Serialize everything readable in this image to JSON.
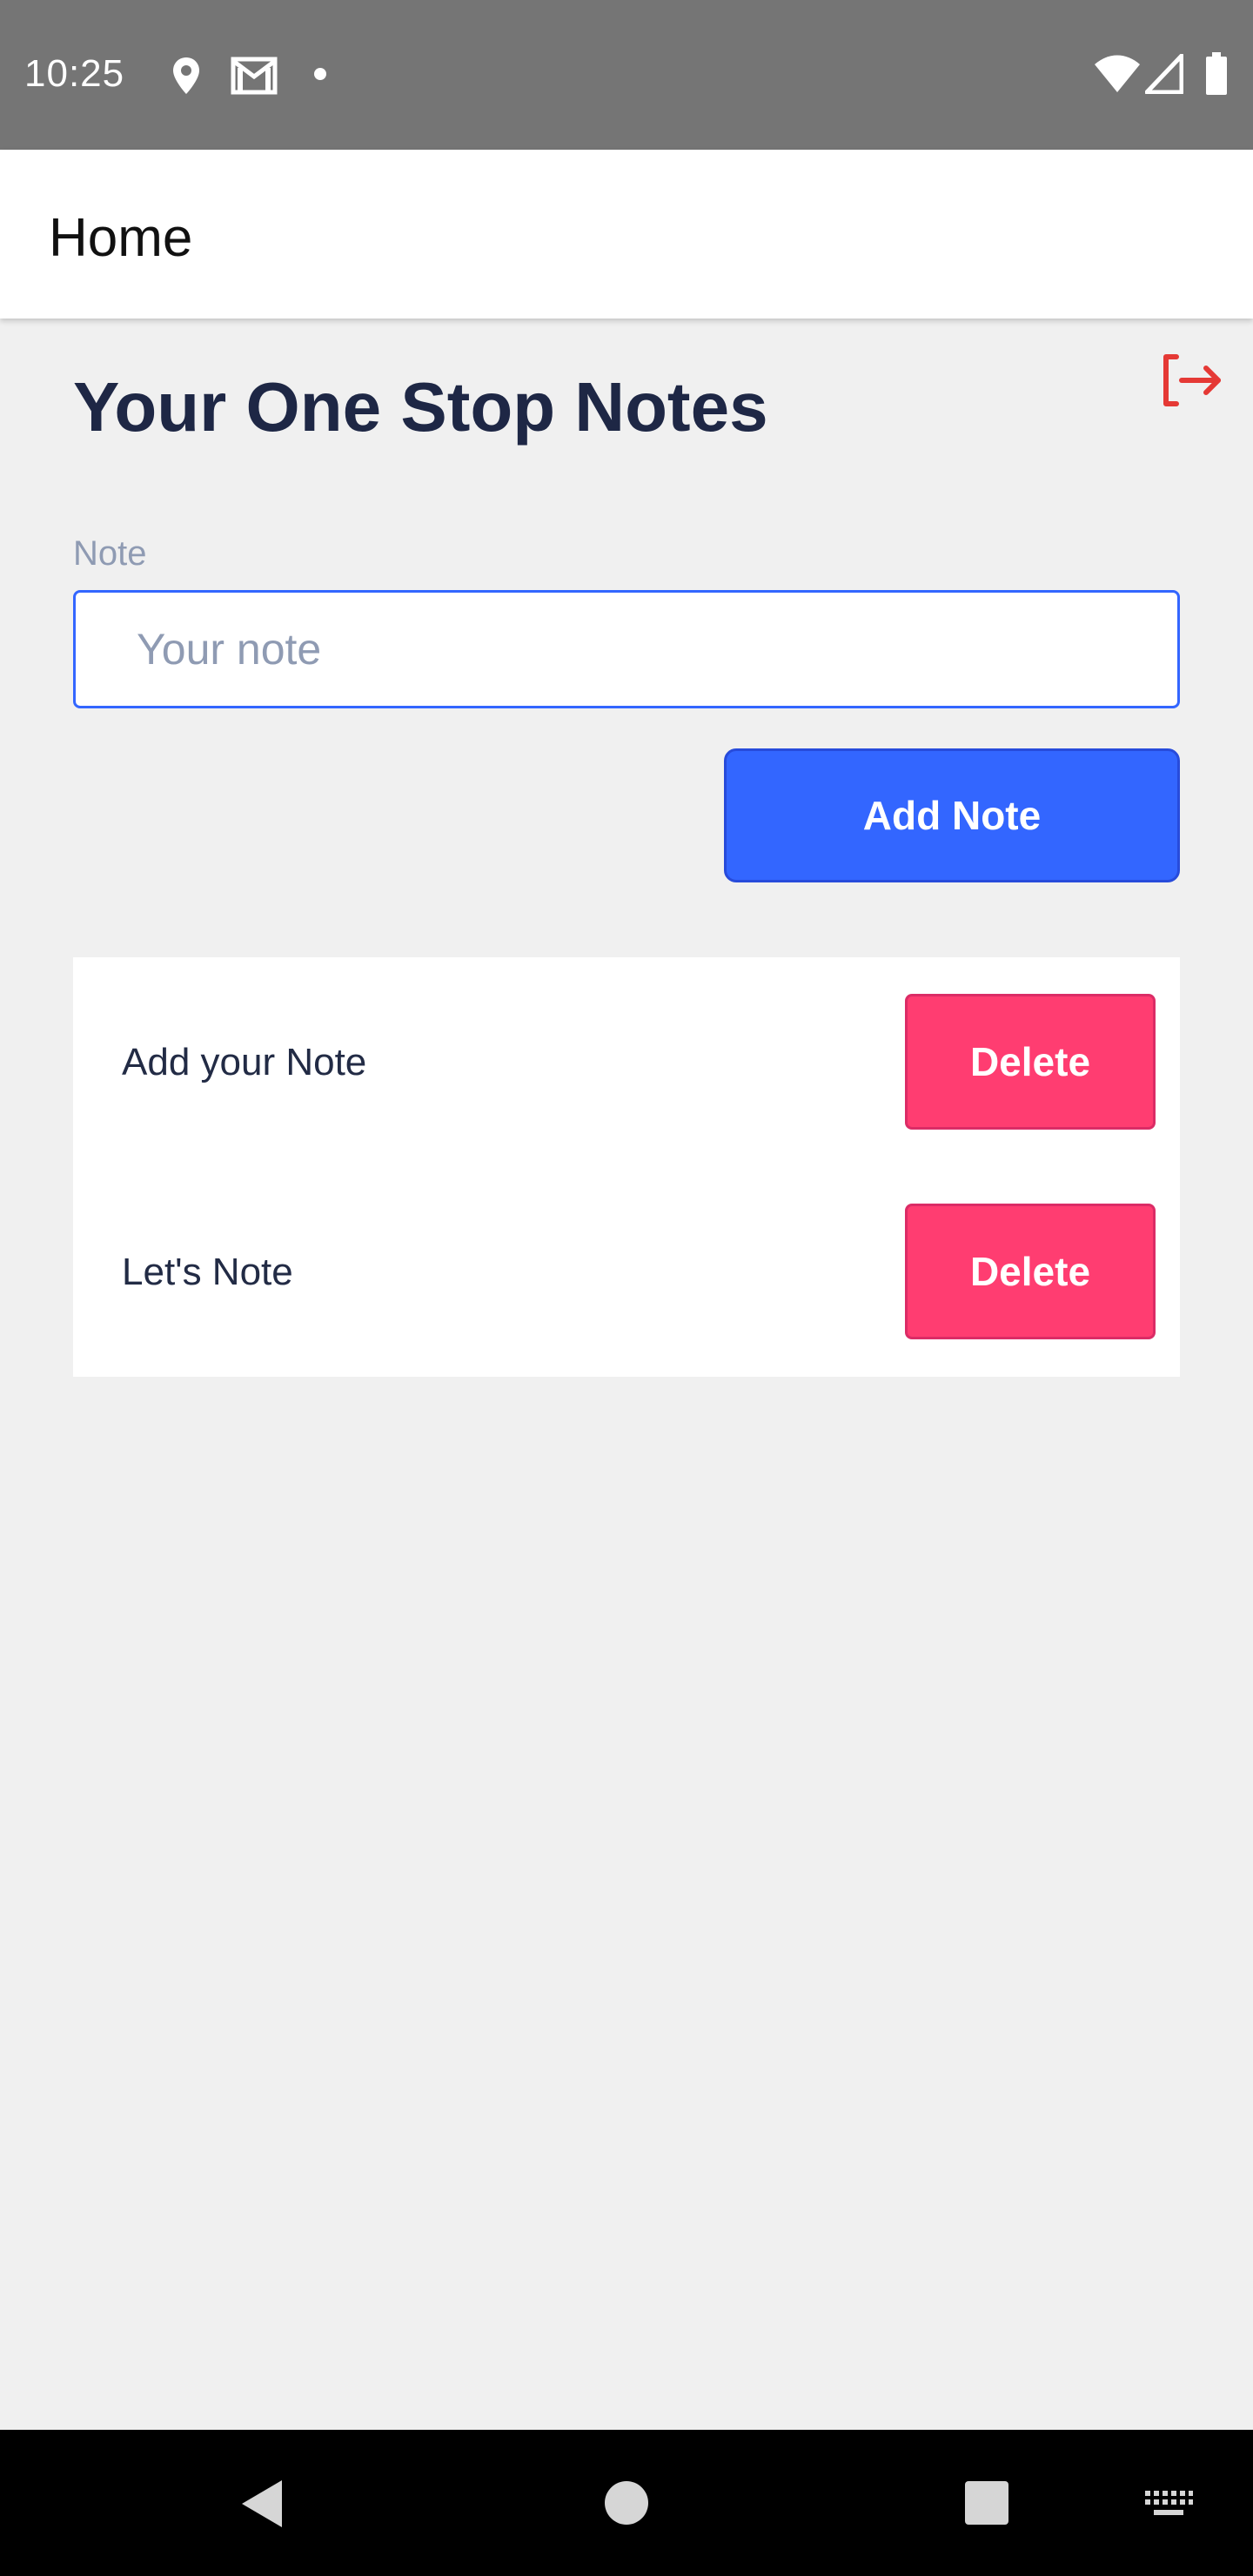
{
  "status_bar": {
    "time": "10:25",
    "icons": [
      "location-icon",
      "gmail-icon",
      "notification-dot-icon",
      "wifi-icon",
      "cell-signal-icon",
      "battery-icon"
    ]
  },
  "app_bar": {
    "title": "Home"
  },
  "main": {
    "heading": "Your One Stop Notes",
    "logout_icon": "logout-icon",
    "accent_color": "#3366ff",
    "danger_color": "#ff3d71",
    "input": {
      "label": "Note",
      "placeholder": "Your note",
      "value": ""
    },
    "add_button_label": "Add Note",
    "notes": [
      {
        "text": "Add your Note",
        "delete_label": "Delete"
      },
      {
        "text": "Let's Note",
        "delete_label": "Delete"
      }
    ]
  },
  "nav_bar": {
    "icons": [
      "back-icon",
      "home-icon",
      "recents-icon",
      "keyboard-icon"
    ]
  }
}
